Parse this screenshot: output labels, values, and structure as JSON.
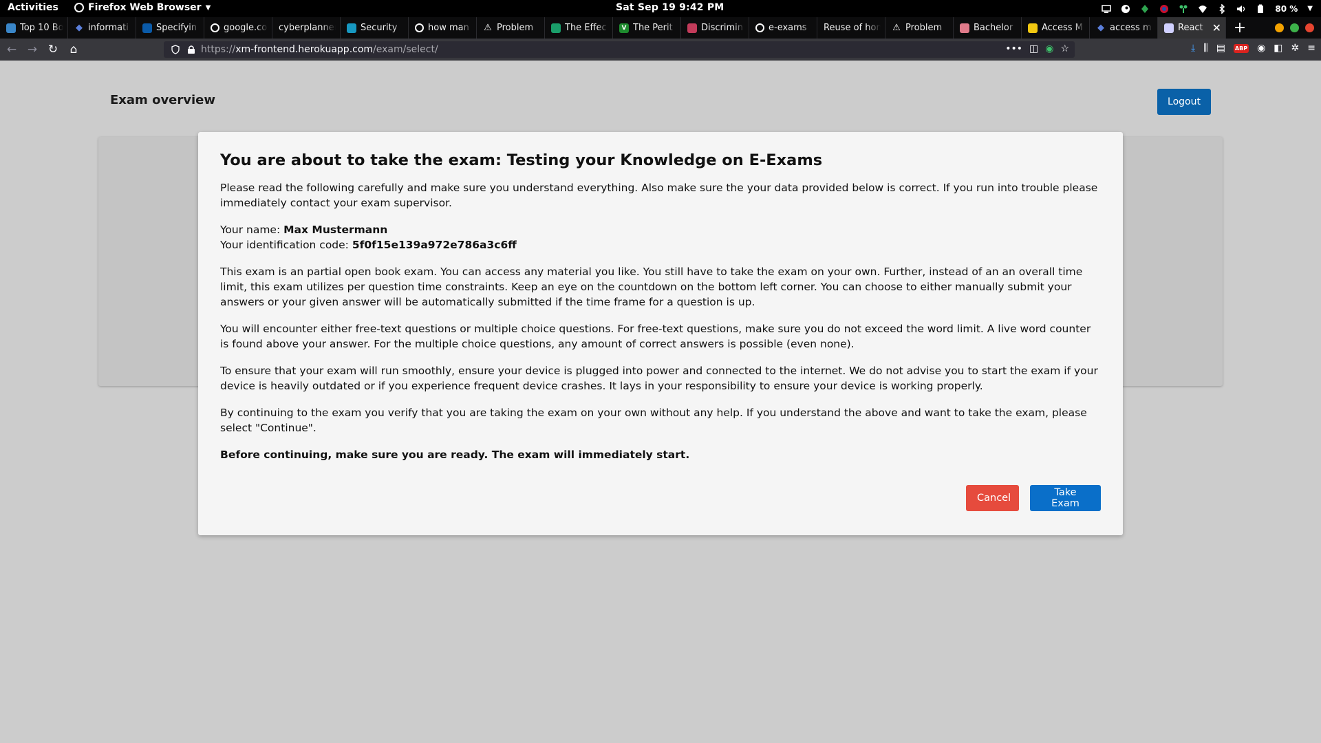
{
  "topbar": {
    "activities": "Activities",
    "app_name": "Firefox Web Browser",
    "clock": "Sat Sep 19   9:42 PM",
    "battery": "80 %"
  },
  "tabs": [
    {
      "label": "Top 10 Bo",
      "icon": "wordpress-icon",
      "color": "#3a86c8"
    },
    {
      "label": "informati",
      "icon": "diamond-icon",
      "color": "#5b7fdb"
    },
    {
      "label": "Specifyin",
      "icon": "ieee-icon",
      "color": "#0a5aa8"
    },
    {
      "label": "google.co",
      "icon": "google-icon",
      "color": "#ffffff"
    },
    {
      "label": "cyberplanner",
      "icon": "",
      "color": ""
    },
    {
      "label": "Security",
      "icon": "salesforce-icon",
      "color": "#1798c1"
    },
    {
      "label": "how man",
      "icon": "google-icon",
      "color": "#ffffff"
    },
    {
      "label": "Problem",
      "icon": "warning-icon",
      "color": "#ffffff"
    },
    {
      "label": "The Effec",
      "icon": "globe-icon",
      "color": "#1a9e6a"
    },
    {
      "label": "The Perit",
      "icon": "v-icon",
      "color": "#1e8a2e"
    },
    {
      "label": "Discrimin",
      "icon": "research-icon",
      "color": "#c23b5a"
    },
    {
      "label": "e-exams",
      "icon": "google-icon",
      "color": "#ffffff"
    },
    {
      "label": "Reuse of hon",
      "icon": "",
      "color": ""
    },
    {
      "label": "Problem",
      "icon": "warning-icon",
      "color": "#ffffff"
    },
    {
      "label": "Bachelor",
      "icon": "brain-icon",
      "color": "#e07a8a"
    },
    {
      "label": "Access M",
      "icon": "access-icon",
      "color": "#f2c811"
    },
    {
      "label": "access m",
      "icon": "diamond-icon",
      "color": "#5b7fdb"
    },
    {
      "label": "React",
      "icon": "react-icon",
      "color": "#d0d0ff"
    }
  ],
  "url": {
    "prefix": "https://",
    "host": "xm-frontend.herokuapp.com",
    "path": "/exam/select/"
  },
  "page": {
    "title": "Exam overview",
    "logout_label": "Logout"
  },
  "modal": {
    "heading": "You are about to take the exam: Testing your Knowledge on E-Exams",
    "intro": "Please read the following carefully and make sure you understand everything. Also make sure the your data provided below is correct. If you run into trouble please immediately contact your exam supervisor.",
    "name_label": "Your name: ",
    "name_value": "Max Mustermann",
    "id_label": "Your identification code: ",
    "id_value": "5f0f15e139a972e786a3c6ff",
    "para_openbook": "This exam is an partial open book exam. You can access any material you like. You still have to take the exam on your own. Further, instead of an an overall time limit, this exam utilizes per question time constraints. Keep an eye on the countdown on the bottom left corner. You can choose to either manually submit your answers or your given answer will be automatically submitted if the time frame for a question is up.",
    "para_questions": "You will encounter either free-text questions or multiple choice questions. For free-text questions, make sure you do not exceed the word limit. A live word counter is found above your answer. For the multiple choice questions, any amount of correct answers is possible (even none).",
    "para_device": "To ensure that your exam will run smoothly, ensure your device is plugged into power and connected to the internet. We do not advise you to start the exam if your device is heavily outdated or if you experience frequent device crashes. It lays in your responsibility to ensure your device is working properly.",
    "para_continue": "By continuing to the exam you verify that you are taking the exam on your own without any help. If you understand the above and want to take the exam, please select \"Continue\".",
    "warning": "Before continuing, make sure you are ready. The exam will immediately start.",
    "cancel_label": "Cancel",
    "take_label": "Take Exam"
  },
  "colors": {
    "primary": "#0a6fc9",
    "logout": "#0a61a8",
    "danger": "#e64b3d",
    "backdrop": "#cccccc",
    "modal_bg": "#f5f5f5"
  }
}
